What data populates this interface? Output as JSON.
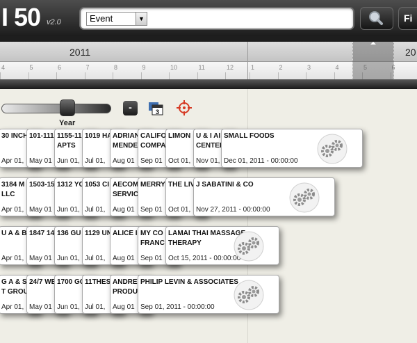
{
  "app": {
    "logo": "I 50",
    "version": "v2.0"
  },
  "search": {
    "type_selected": "Event",
    "value": "",
    "find_label": "Fi"
  },
  "timeline": {
    "year_labels": [
      "2011",
      "20"
    ],
    "months_2011": [
      "4",
      "5",
      "6",
      "7",
      "8",
      "9",
      "10",
      "11",
      "12"
    ],
    "months_2012": [
      "1",
      "2",
      "3",
      "4",
      "5",
      "6"
    ]
  },
  "controls": {
    "slider_label": "Year",
    "zoom_out_label": "-",
    "calendar_badge": "3"
  },
  "rows": [
    [
      {
        "title": "30 INCH",
        "date": "Apr 01,"
      },
      {
        "title": "101-111",
        "date": "May 01"
      },
      {
        "title": "1155-11 APTS",
        "date": "Jun 01,"
      },
      {
        "title": "1019 HA",
        "date": "Jul 01,"
      },
      {
        "title": "ADRIAN MENDE",
        "date": "Aug 01"
      },
      {
        "title": "CALIFO COMPA",
        "date": "Sep 01"
      },
      {
        "title": "LIMON",
        "date": "Oct 01,"
      },
      {
        "title": "U & I AI CENTER",
        "date": "Nov 01,"
      },
      {
        "title": "SMALL FOODS",
        "date": "Dec 01, 2011 - 00:00:00"
      }
    ],
    [
      {
        "title": "3184 M LLC",
        "date": "Apr 01,"
      },
      {
        "title": "1503-15",
        "date": "May 01"
      },
      {
        "title": "1312 YC",
        "date": "Jun 01,"
      },
      {
        "title": "1053 CI",
        "date": "Jul 01,"
      },
      {
        "title": "AECOM SERVIC",
        "date": "Aug 01"
      },
      {
        "title": "MERRY",
        "date": "Sep 01"
      },
      {
        "title": "THE LIV",
        "date": "Oct 01,"
      },
      {
        "title": "J SABATINI & CO",
        "date": "Nov 27, 2011 - 00:00:00"
      }
    ],
    [
      {
        "title": "U A & B I",
        "date": "Apr 01,"
      },
      {
        "title": "1847 14",
        "date": "May 01"
      },
      {
        "title": "136 GU",
        "date": "Jun 01,"
      },
      {
        "title": "1129 UN",
        "date": "Jul 01,"
      },
      {
        "title": "ALICE I",
        "date": "Aug 01"
      },
      {
        "title": "MY CO FRANC",
        "date": "Sep 01"
      },
      {
        "title": "LAMAI THAI MASSAGE THERAPY",
        "date": "Oct 15, 2011 - 00:00:00"
      }
    ],
    [
      {
        "title": "G A & S E T GROUP",
        "date": "Apr 01,"
      },
      {
        "title": "24/7 WE",
        "date": "May 01"
      },
      {
        "title": "1700 GC",
        "date": "Jun 01,"
      },
      {
        "title": "11THES",
        "date": "Jul 01,"
      },
      {
        "title": "ANDREV PRODU",
        "date": "Aug 01"
      },
      {
        "title": "PHILIP LEVIN & ASSOCIATES",
        "date": "Sep 01, 2011 - 00:00:00"
      }
    ]
  ]
}
